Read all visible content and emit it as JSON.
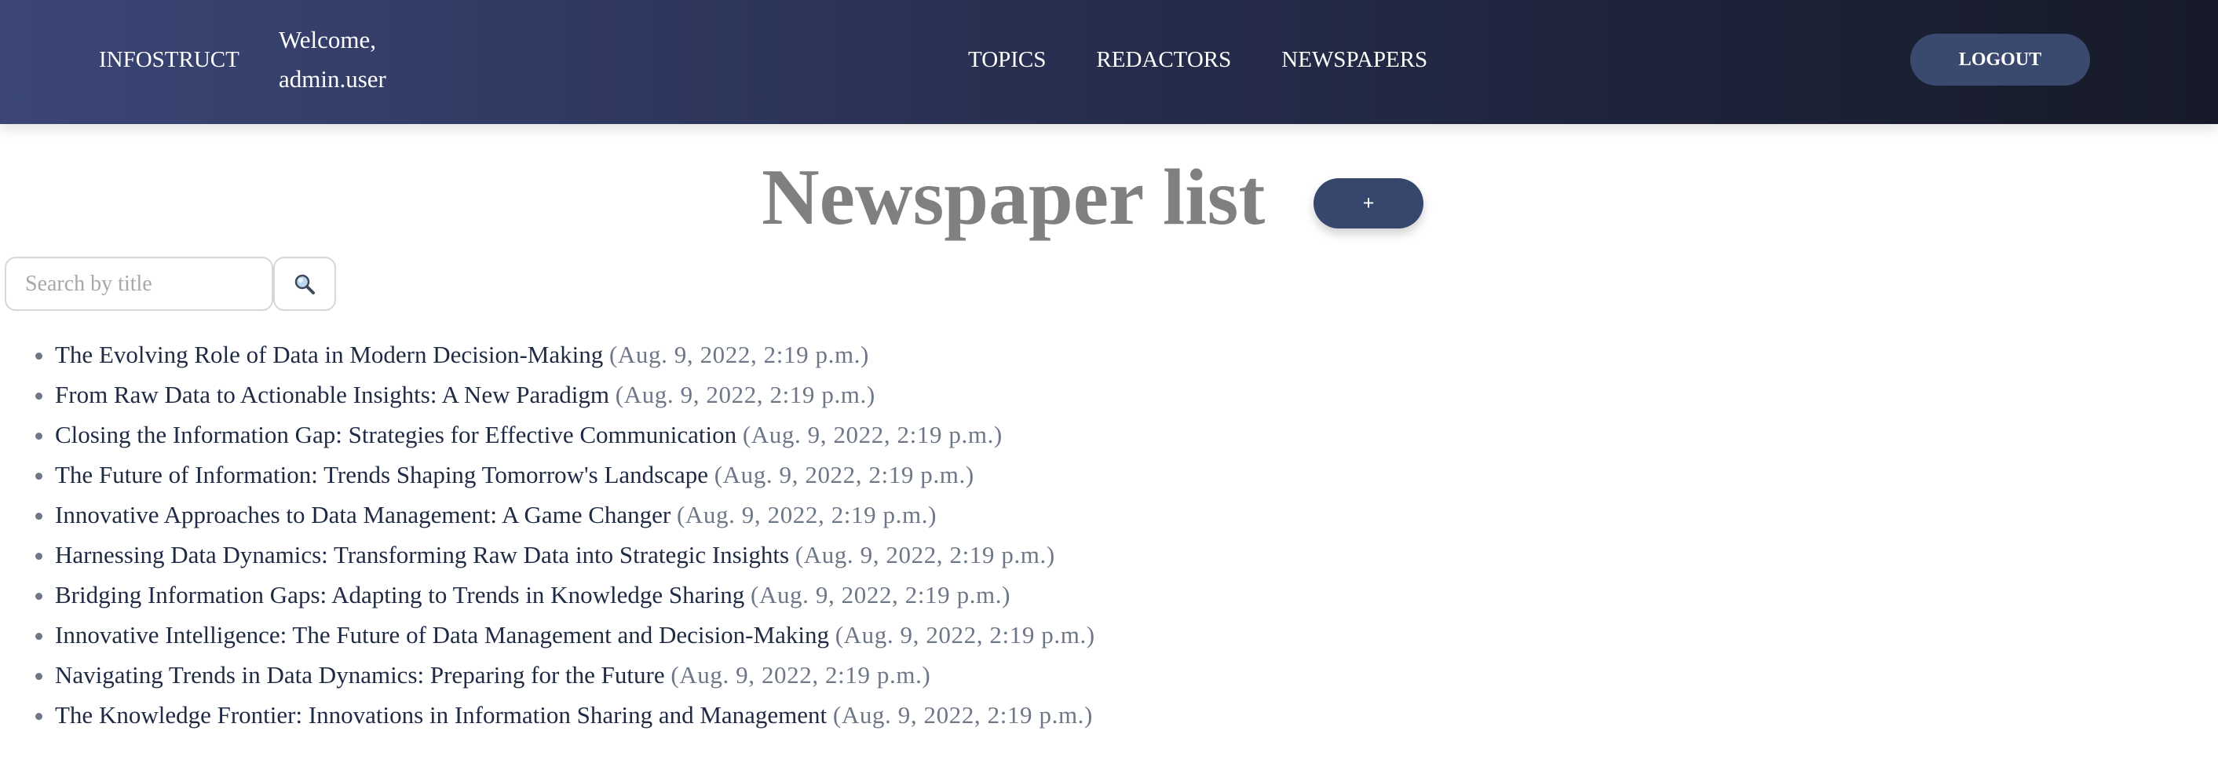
{
  "navbar": {
    "brand": "INFOSTRUCT",
    "welcome_line1": "Welcome,",
    "welcome_line2": "admin.user",
    "links": [
      "TOPICS",
      "REDACTORS",
      "NEWSPAPERS"
    ],
    "logout_label": "LOGOUT"
  },
  "main": {
    "title": "Newspaper list",
    "add_label": "+",
    "search_placeholder": "Search by title",
    "search_icon": "magnifier-icon",
    "newspapers": [
      {
        "title": "The Evolving Role of Data in Modern Decision-Making",
        "date": "(Aug. 9, 2022, 2:19 p.m.)"
      },
      {
        "title": "From Raw Data to Actionable Insights: A New Paradigm",
        "date": "(Aug. 9, 2022, 2:19 p.m.)"
      },
      {
        "title": "Closing the Information Gap: Strategies for Effective Communication",
        "date": "(Aug. 9, 2022, 2:19 p.m.)"
      },
      {
        "title": "The Future of Information: Trends Shaping Tomorrow's Landscape",
        "date": "(Aug. 9, 2022, 2:19 p.m.)"
      },
      {
        "title": "Innovative Approaches to Data Management: A Game Changer",
        "date": "(Aug. 9, 2022, 2:19 p.m.)"
      },
      {
        "title": "Harnessing Data Dynamics: Transforming Raw Data into Strategic Insights",
        "date": "(Aug. 9, 2022, 2:19 p.m.)"
      },
      {
        "title": "Bridging Information Gaps: Adapting to Trends in Knowledge Sharing",
        "date": "(Aug. 9, 2022, 2:19 p.m.)"
      },
      {
        "title": "Innovative Intelligence: The Future of Data Management and Decision-Making",
        "date": "(Aug. 9, 2022, 2:19 p.m.)"
      },
      {
        "title": "Navigating Trends in Data Dynamics: Preparing for the Future",
        "date": "(Aug. 9, 2022, 2:19 p.m.)"
      },
      {
        "title": "The Knowledge Frontier: Innovations in Information Sharing and Management",
        "date": "(Aug. 9, 2022, 2:19 p.m.)"
      }
    ]
  },
  "colors": {
    "navbar_gradient_start": "#3b4676",
    "navbar_gradient_end": "#161a28",
    "button_bg": "#36466c",
    "title_gray": "#808080",
    "link_dark": "#1f2a44",
    "date_gray": "#6e7787"
  }
}
